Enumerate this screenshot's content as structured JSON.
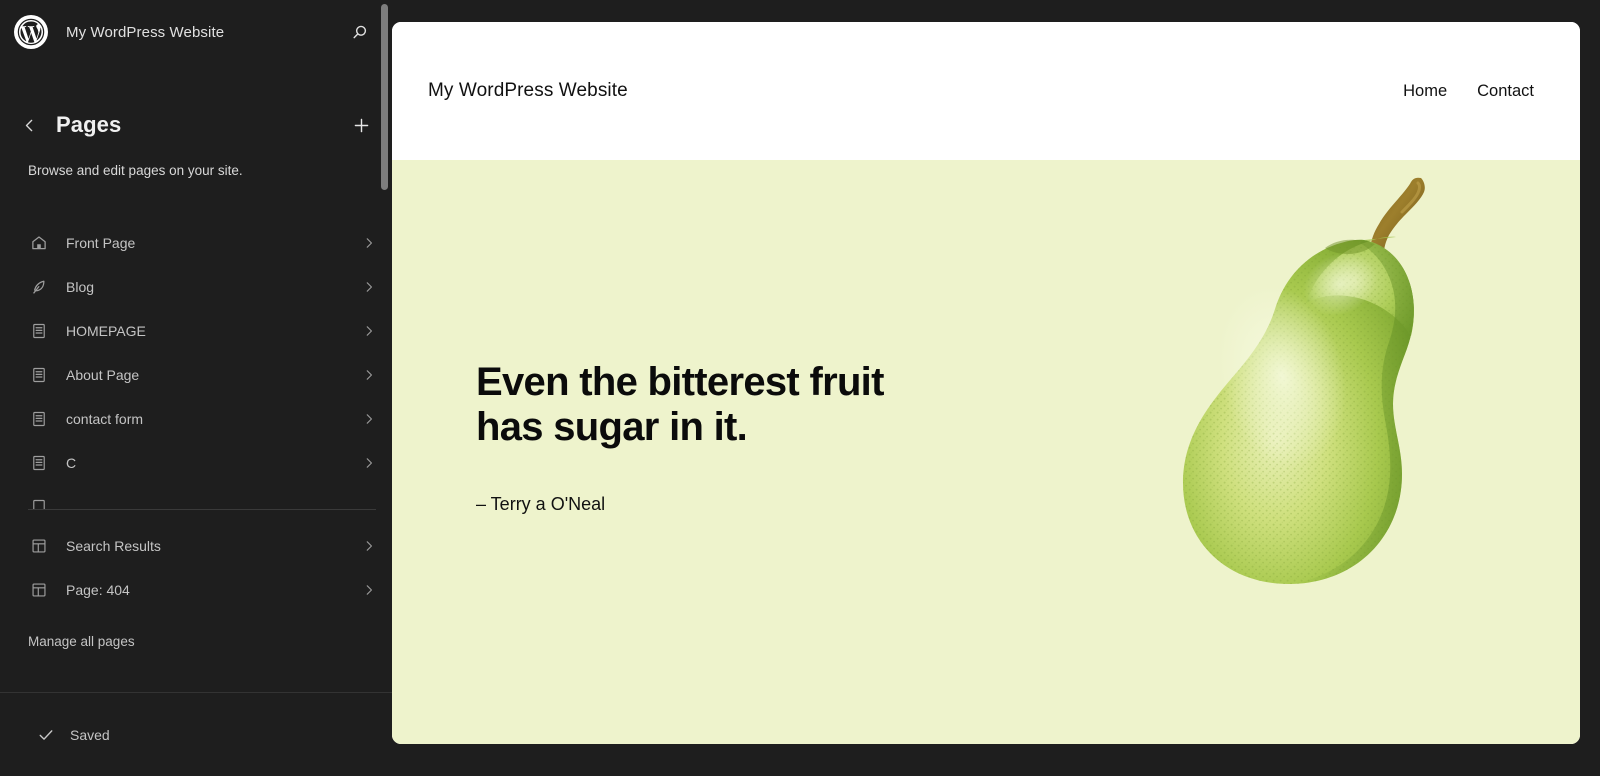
{
  "sidebar": {
    "logo_icon": "wordpress-logo-icon",
    "site_title": "My WordPress Website",
    "search_icon": "search-icon",
    "back_icon": "chevron-left-icon",
    "panel_title": "Pages",
    "add_icon": "plus-icon",
    "panel_description": "Browse and edit pages on your site.",
    "pages": [
      {
        "label": "Front Page",
        "icon": "home-icon",
        "chevron": "chevron-right-icon"
      },
      {
        "label": "Blog",
        "icon": "quill-icon",
        "chevron": "chevron-right-icon"
      },
      {
        "label": "HOMEPAGE",
        "icon": "page-icon",
        "chevron": "chevron-right-icon"
      },
      {
        "label": "About Page",
        "icon": "page-icon",
        "chevron": "chevron-right-icon"
      },
      {
        "label": "contact form",
        "icon": "page-icon",
        "chevron": "chevron-right-icon"
      },
      {
        "label": "C",
        "icon": "page-icon",
        "chevron": "chevron-right-icon"
      }
    ],
    "templates": [
      {
        "label": "Search Results",
        "icon": "template-icon",
        "chevron": "chevron-right-icon"
      },
      {
        "label": "Page: 404",
        "icon": "template-icon",
        "chevron": "chevron-right-icon"
      }
    ],
    "manage_link": "Manage all pages",
    "footer": {
      "status_icon": "check-icon",
      "status_label": "Saved"
    }
  },
  "preview": {
    "site_header": {
      "brand": "My WordPress Website",
      "nav": [
        {
          "label": "Home"
        },
        {
          "label": "Contact"
        }
      ]
    },
    "hero": {
      "background_color": "#eef3cc",
      "quote_line_1": "Even the bitterest fruit",
      "quote_line_2": "has sugar in it.",
      "attribution": "– Terry a O'Neal",
      "image_icon": "pear-illustration"
    }
  },
  "colors": {
    "app_background": "#1e1e1e",
    "sidebar_background": "#1e1e1e",
    "preview_background": "#ffffff",
    "hero_background": "#eef3cc",
    "text_primary": "#f0f0f0",
    "text_secondary": "#c4c4c4",
    "icon_muted": "#9e9e9e",
    "scrollbar": "#7d7d7d"
  }
}
